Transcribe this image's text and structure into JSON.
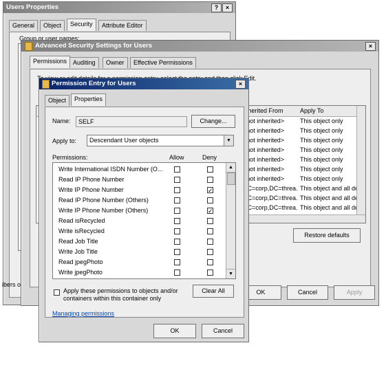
{
  "users_props": {
    "title": "Users Properties",
    "tabs": [
      "General",
      "Object",
      "Security",
      "Attribute Editor"
    ],
    "group_label": "Group or user names:",
    "side_text": "ibers o"
  },
  "adv": {
    "title": "Advanced Security Settings for Users",
    "tabs": [
      "Permissions",
      "Auditing",
      "Owner",
      "Effective Permissions"
    ],
    "intro": "To view or edit details for a permission entry, select the entry and then click Edit.",
    "columns": [
      "Inherited From",
      "Apply To"
    ],
    "rows": [
      {
        "inherited": "<not inherited>",
        "apply": "This object only"
      },
      {
        "inherited": "<not inherited>",
        "apply": "This object only"
      },
      {
        "inherited": "<not inherited>",
        "apply": "This object only"
      },
      {
        "inherited": "<not inherited>",
        "apply": "This object only"
      },
      {
        "inherited": "<not inherited>",
        "apply": "This object only"
      },
      {
        "inherited": "<not inherited>",
        "apply": "This object only"
      },
      {
        "inherited": "<not inherited>",
        "apply": "This object only"
      },
      {
        "inherited": "DC=corp,DC=threa...",
        "apply": "This object and all de"
      },
      {
        "inherited": "DC=corp,DC=threa...",
        "apply": "This object and all de"
      },
      {
        "inherited": "DC=corp,DC=threa...",
        "apply": "This object and all de"
      }
    ],
    "restore_label": "Restore defaults",
    "ok_label": "OK",
    "cancel_label": "Cancel",
    "apply_label": "Apply"
  },
  "perm": {
    "title": "Permission Entry for Users",
    "tabs": [
      "Object",
      "Properties"
    ],
    "name_label": "Name:",
    "name_value": "SELF",
    "change_label": "Change...",
    "applyto_label": "Apply to:",
    "applyto_value": "Descendant User objects",
    "permissions_label": "Permissions:",
    "allow_label": "Allow",
    "deny_label": "Deny",
    "items": [
      {
        "name": "Write International ISDN Number (O...",
        "allow": false,
        "deny": false
      },
      {
        "name": "Read IP Phone Number",
        "allow": false,
        "deny": false
      },
      {
        "name": "Write IP Phone Number",
        "allow": false,
        "deny": true
      },
      {
        "name": "Read IP Phone Number (Others)",
        "allow": false,
        "deny": false
      },
      {
        "name": "Write IP Phone Number (Others)",
        "allow": false,
        "deny": true
      },
      {
        "name": "Read isRecycled",
        "allow": false,
        "deny": false
      },
      {
        "name": "Write isRecycled",
        "allow": false,
        "deny": false
      },
      {
        "name": "Read Job Title",
        "allow": false,
        "deny": false
      },
      {
        "name": "Write Job Title",
        "allow": false,
        "deny": false
      },
      {
        "name": "Read jpegPhoto",
        "allow": false,
        "deny": false
      },
      {
        "name": "Write jpegPhoto",
        "allow": false,
        "deny": false
      }
    ],
    "apply_inherit_label": "Apply these permissions to objects and/or containers within this container only",
    "clear_all_label": "Clear All",
    "managing_link": "Managing permissions",
    "ok_label": "OK",
    "cancel_label": "Cancel"
  },
  "colors": {
    "title_active": "#0a246a",
    "title_inactive": "#808080",
    "link": "#0645ad"
  }
}
